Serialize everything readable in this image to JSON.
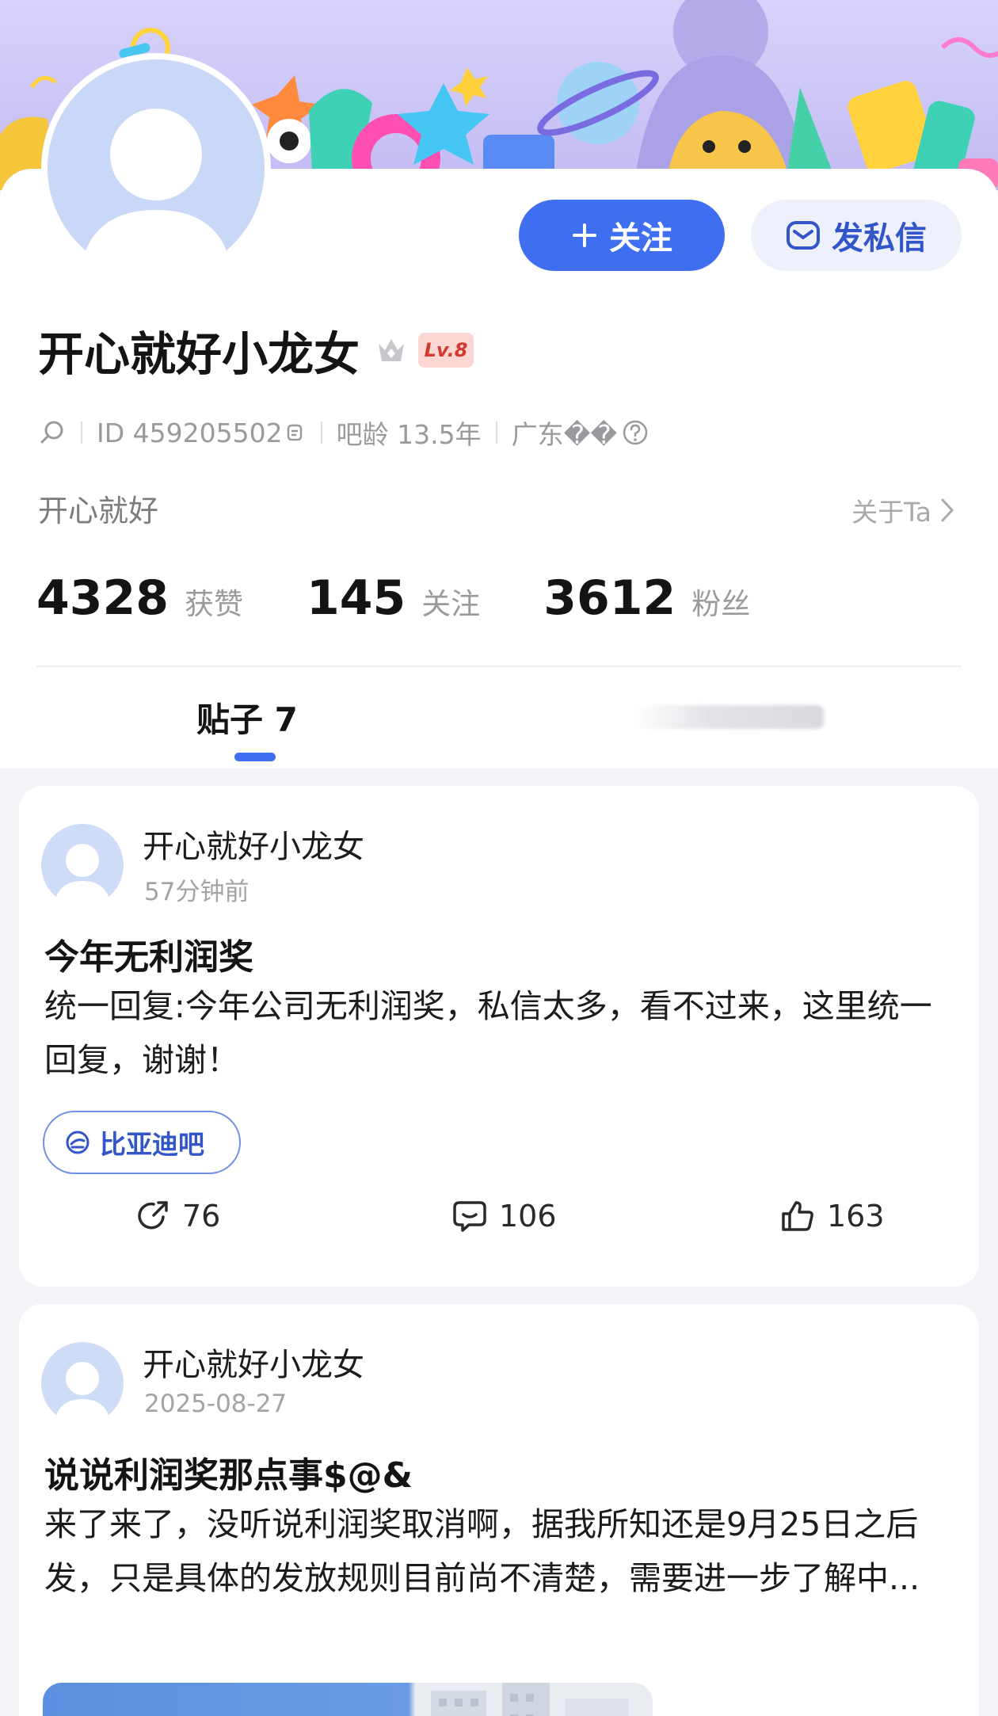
{
  "profile": {
    "follow_label": "关注",
    "message_label": "发私信",
    "username": "开心就好小龙女",
    "level": "Lv.8",
    "id_text": "ID 459205502",
    "bar_age": "吧龄 13.5年",
    "location": "广东��",
    "bio": "开心就好",
    "about_label": "关于Ta",
    "stats": [
      {
        "value": "4328",
        "label": "获赞"
      },
      {
        "value": "145",
        "label": "关注"
      },
      {
        "value": "3612",
        "label": "粉丝"
      }
    ]
  },
  "tabs": {
    "posts_label": "贴子 7"
  },
  "posts": [
    {
      "author": "开心就好小龙女",
      "time": "57分钟前",
      "title": "今年无利润奖",
      "body": "统一回复:今年公司无利润奖，私信太多，看不过来，这里统一回复，谢谢！",
      "forum": "比亚迪吧",
      "shares": "76",
      "comments": "106",
      "likes": "163"
    },
    {
      "author": "开心就好小龙女",
      "time": "2025-08-27",
      "title": "说说利润奖那点事$@&",
      "body": "来了来了，没听说利润奖取消啊，据我所知还是9月25日之后发，只是具体的发放规则目前尚不清楚，需要进一步了解中..."
    }
  ],
  "colors": {
    "accent": "#3f6ff0",
    "banner": "#cbc4f6",
    "badge_red": "#d2392f"
  },
  "icons": [
    "search-icon",
    "copy-icon",
    "help-icon",
    "mail-icon",
    "plus-icon",
    "crown-icon",
    "chevron-right-icon",
    "share-icon",
    "comment-icon",
    "like-icon",
    "forum-icon"
  ]
}
